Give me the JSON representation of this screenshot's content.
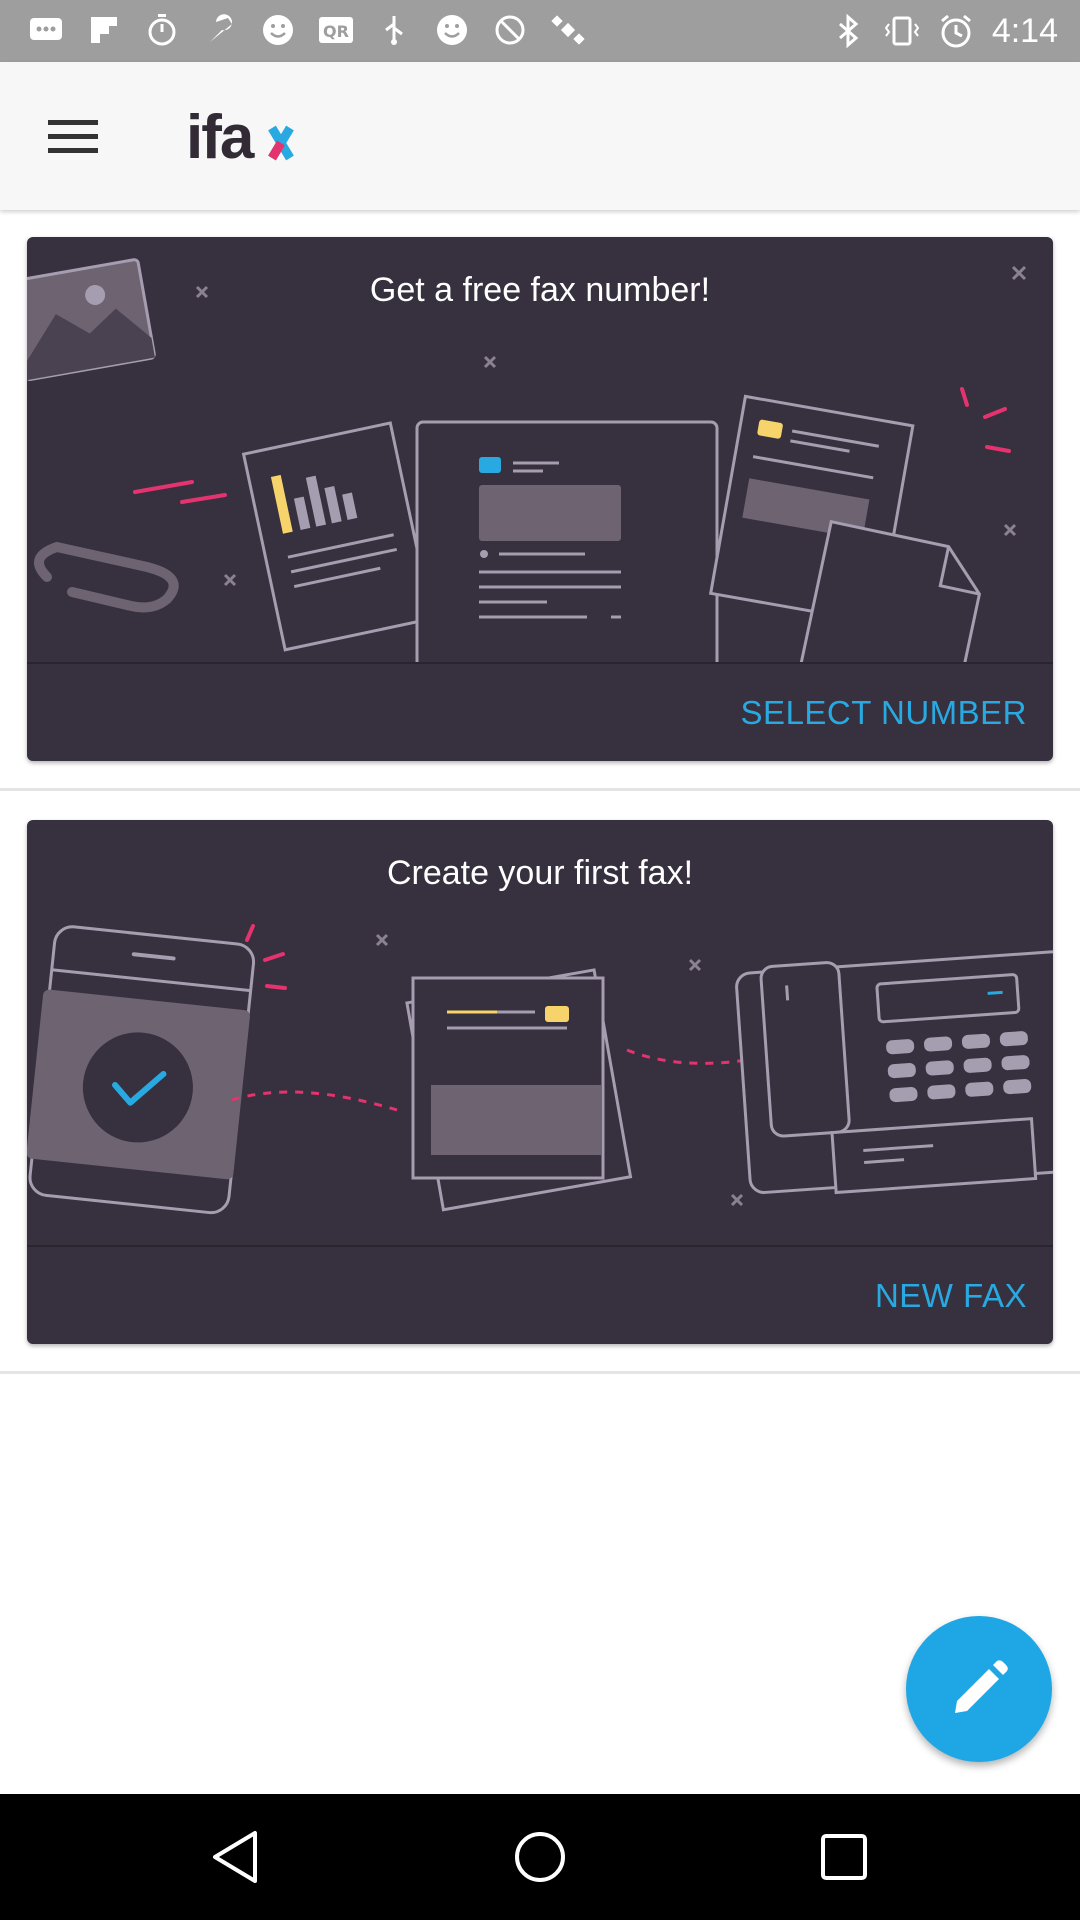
{
  "status_bar": {
    "time": "4:14",
    "left_icons": [
      "messages-icon",
      "flipboard-icon",
      "timer-icon",
      "wrench-icon",
      "smiley-icon",
      "qr-icon",
      "usb-icon",
      "smiley-icon",
      "block-icon",
      "satellite-icon"
    ],
    "right_icons": [
      "bluetooth-icon",
      "vibrate-icon",
      "alarm-icon"
    ]
  },
  "app_bar": {
    "logo_text": "ifax",
    "menu_icon": "hamburger-menu-icon"
  },
  "cards": [
    {
      "title": "Get a free fax number!",
      "action": "SELECT NUMBER"
    },
    {
      "title": "Create your first fax!",
      "action": "NEW FAX"
    }
  ],
  "fab": {
    "icon": "pencil-icon"
  },
  "nav_bar": {
    "back": "back-icon",
    "home": "home-icon",
    "recents": "recents-icon"
  },
  "colors": {
    "accent": "#29a9e1",
    "card_bg": "#37303e",
    "fab_bg": "#1ea7e4",
    "pink": "#e4336e",
    "yellow": "#f6d36b"
  }
}
